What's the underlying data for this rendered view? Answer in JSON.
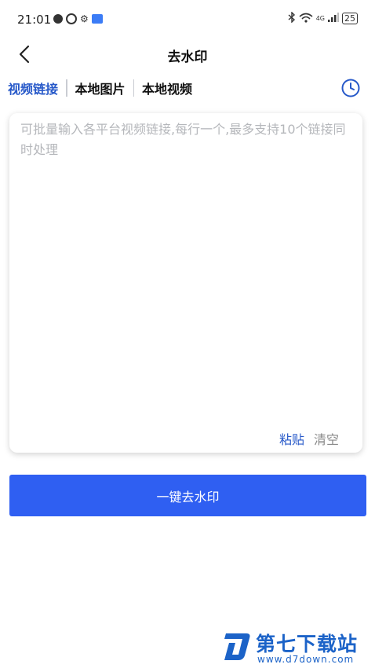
{
  "status_bar": {
    "time": "21:01",
    "network": "4G",
    "battery": "25"
  },
  "header": {
    "title": "去水印"
  },
  "tabs": [
    {
      "label": "视频链接",
      "active": true
    },
    {
      "label": "本地图片",
      "active": false
    },
    {
      "label": "本地视频",
      "active": false
    }
  ],
  "input": {
    "placeholder": "可批量输入各平台视频链接,每行一个,最多支持10个链接同时处理",
    "value": "",
    "paste_label": "粘贴",
    "clear_label": "清空"
  },
  "action": {
    "button_label": "一键去水印"
  },
  "watermark": {
    "name": "第七下载站",
    "url": "www.d7down.com"
  },
  "colors": {
    "accent": "#2759c9",
    "button": "#2f5ff2",
    "watermark": "#1c63c8"
  }
}
